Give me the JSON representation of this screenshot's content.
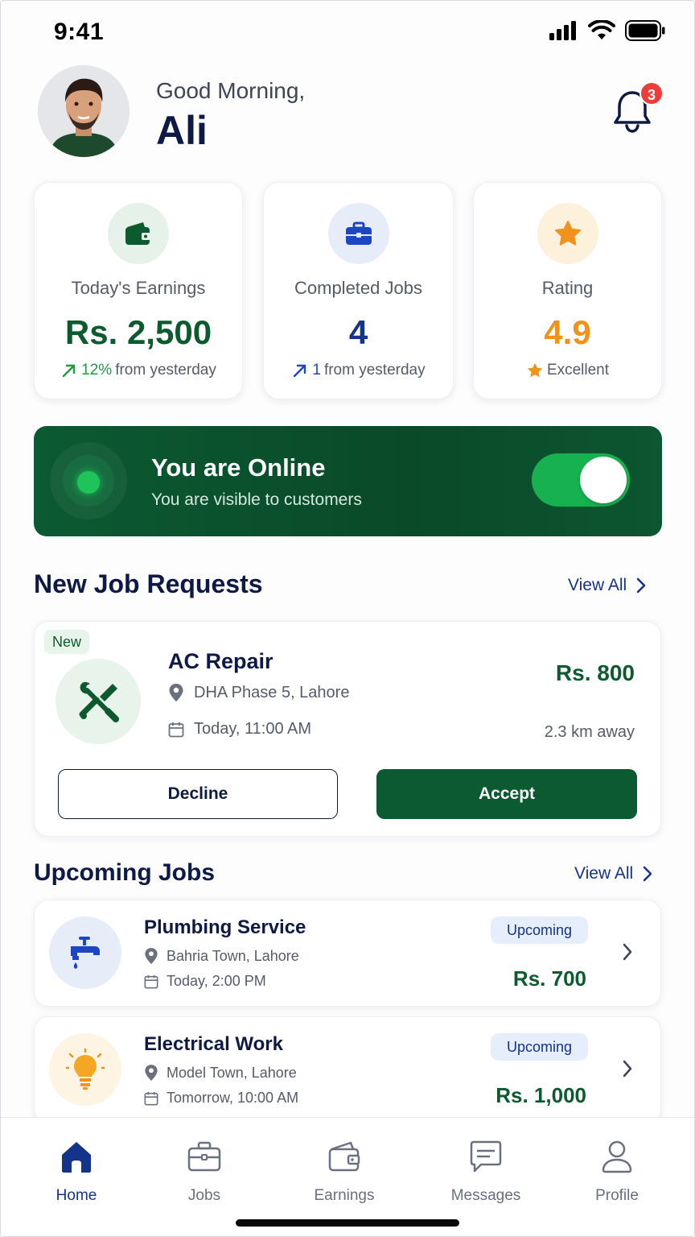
{
  "status_bar": {
    "time": "9:41"
  },
  "header": {
    "greeting": "Good Morning,",
    "name": "Ali",
    "notification_count": "3"
  },
  "stats": [
    {
      "label": "Today's Earnings",
      "value": "Rs. 2,500",
      "trend": "12%",
      "trend_text": "from yesterday",
      "icon": "wallet-icon",
      "color": "#0d5a2e",
      "icon_bg": "#e6f1ea"
    },
    {
      "label": "Completed Jobs",
      "value": "4",
      "trend": "1",
      "trend_text": "from yesterday",
      "icon": "briefcase-icon",
      "color": "#14338a",
      "icon_bg": "#e7ecf9"
    },
    {
      "label": "Rating",
      "value": "4.9",
      "trend_text": "Excellent",
      "icon": "star-icon",
      "color": "#f0931e",
      "icon_bg": "#fdf1dc"
    }
  ],
  "online": {
    "title": "You are Online",
    "subtitle": "You are visible to customers",
    "enabled": true
  },
  "new_requests": {
    "title": "New Job Requests",
    "view_all": "View All",
    "job": {
      "badge": "New",
      "title": "AC Repair",
      "location": "DHA Phase 5, Lahore",
      "time": "Today, 11:00 AM",
      "price": "Rs. 800",
      "distance": "2.3 km away",
      "decline_label": "Decline",
      "accept_label": "Accept",
      "icon": "tools-icon"
    }
  },
  "upcoming": {
    "title": "Upcoming Jobs",
    "view_all": "View All",
    "jobs": [
      {
        "title": "Plumbing Service",
        "location": "Bahria Town, Lahore",
        "time": "Today, 2:00 PM",
        "status": "Upcoming",
        "price": "Rs. 700",
        "icon": "faucet-icon"
      },
      {
        "title": "Electrical Work",
        "location": "Model Town, Lahore",
        "time": "Tomorrow, 10:00 AM",
        "status": "Upcoming",
        "price": "Rs. 1,000",
        "icon": "lightbulb-icon"
      }
    ]
  },
  "nav": [
    {
      "label": "Home",
      "icon": "home-icon",
      "active": true
    },
    {
      "label": "Jobs",
      "icon": "briefcase-icon"
    },
    {
      "label": "Earnings",
      "icon": "wallet-icon"
    },
    {
      "label": "Messages",
      "icon": "message-icon"
    },
    {
      "label": "Profile",
      "icon": "user-icon"
    }
  ],
  "colors": {
    "brand_green": "#0b5a32",
    "brand_blue": "#14338a",
    "accent_orange": "#f0931e",
    "badge_red": "#ee3b3b"
  }
}
